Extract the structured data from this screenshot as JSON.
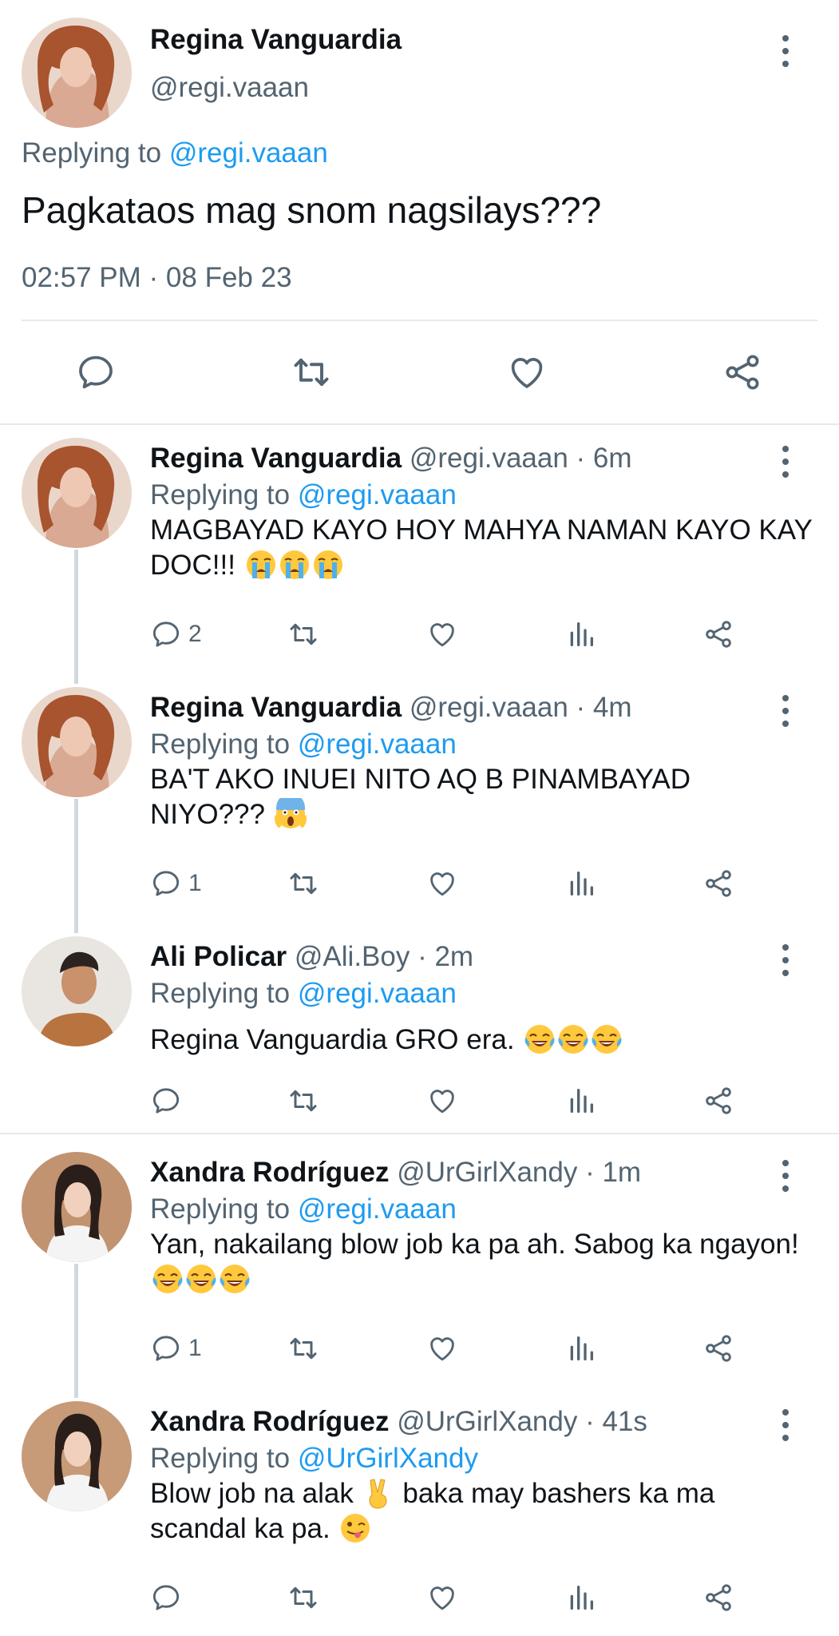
{
  "main_tweet": {
    "name": "Regina Vanguardia",
    "handle": "@regi.vaaan",
    "replying_prefix": "Replying to ",
    "replying_to": "@regi.vaaan",
    "text": "Pagkataos mag snom nagsilays???",
    "timestamp": "02:57 PM · 08 Feb 23",
    "actions": [
      "reply-icon",
      "retweet-icon",
      "like-icon",
      "share-icon"
    ]
  },
  "replies": [
    {
      "name": "Regina Vanguardia",
      "handle_time": "@regi.vaaan · 6m",
      "replying_prefix": "Replying to ",
      "replying_to": "@regi.vaaan",
      "text": "MAGBAYAD KAYO HOY MAHYA NAMAN KAYO KAY DOC!!!",
      "emojis": [
        "loudly-crying-face",
        "loudly-crying-face",
        "loudly-crying-face"
      ],
      "reply_count": "2"
    },
    {
      "name": "Regina Vanguardia",
      "handle_time": "@regi.vaaan · 4m",
      "replying_prefix": "Replying to ",
      "replying_to": "@regi.vaaan",
      "text": "BA'T AKO INUEI NITO AQ B PINAMBAYAD NIYO???",
      "emojis": [
        "screaming-face"
      ],
      "reply_count": "1"
    },
    {
      "name": "Ali Policar",
      "handle_time": "@Ali.Boy · 2m",
      "replying_prefix": "Replying to ",
      "replying_to": "@regi.vaaan",
      "text": "Regina Vanguardia GRO era.",
      "emojis": [
        "tears-of-joy",
        "tears-of-joy",
        "tears-of-joy"
      ],
      "reply_count": ""
    },
    {
      "name": "Xandra Rodríguez",
      "handle_time": "@UrGirlXandy · 1m",
      "replying_prefix": "Replying to ",
      "replying_to": "@regi.vaaan",
      "text": "Yan, nakailang blow job ka pa ah. Sabog ka ngayon!",
      "emojis": [
        "tears-of-joy",
        "tears-of-joy",
        "tears-of-joy"
      ],
      "reply_count": "1"
    },
    {
      "name": "Xandra Rodríguez",
      "handle_time": "@UrGirlXandy · 41s",
      "replying_prefix": "Replying to ",
      "replying_to": "@UrGirlXandy",
      "text_part1": "Blow job na alak",
      "text_part2": "baka may bashers ka ma scandal ka pa.",
      "emojis": [
        "victory-hand",
        "winking-face-tongue"
      ],
      "reply_count": ""
    }
  ],
  "colors": {
    "link": "#1d9bf0",
    "secondary_text": "#536471",
    "divider": "#e6e9eb",
    "thread_line": "#cfd9de"
  }
}
